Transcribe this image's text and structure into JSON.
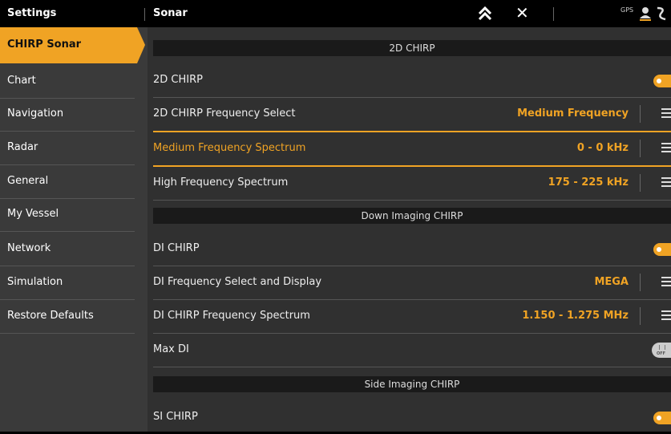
{
  "topbar": {
    "settings_title": "Settings",
    "page_title": "Sonar",
    "gps_label": "GPS"
  },
  "sidebar": {
    "items": [
      {
        "label": "CHIRP Sonar",
        "active": true
      },
      {
        "label": "Chart"
      },
      {
        "label": "Navigation"
      },
      {
        "label": "Radar"
      },
      {
        "label": "General"
      },
      {
        "label": "My Vessel"
      },
      {
        "label": "Network"
      },
      {
        "label": "Simulation"
      },
      {
        "label": "Restore Defaults"
      }
    ]
  },
  "sections": {
    "chirp2d": {
      "header": "2D CHIRP",
      "rows": [
        {
          "label": "2D CHIRP",
          "toggle": "on"
        },
        {
          "label": "2D CHIRP Frequency Select",
          "value": "Medium Frequency"
        },
        {
          "label": "Medium Frequency Spectrum",
          "value": "0 - 0 kHz",
          "selected": true
        },
        {
          "label": "High Frequency Spectrum",
          "value": "175 - 225 kHz"
        }
      ]
    },
    "di": {
      "header": "Down Imaging CHIRP",
      "rows": [
        {
          "label": "DI CHIRP",
          "toggle": "on"
        },
        {
          "label": "DI Frequency Select and Display",
          "value": "MEGA"
        },
        {
          "label": "DI CHIRP Frequency Spectrum",
          "value": "1.150 - 1.275 MHz"
        },
        {
          "label": "Max DI",
          "toggle": "off",
          "toggle_label": "OFF"
        }
      ]
    },
    "si": {
      "header": "Side Imaging CHIRP",
      "rows": [
        {
          "label": "SI CHIRP",
          "toggle": "on"
        }
      ]
    }
  },
  "colors": {
    "accent": "#f0a324",
    "background": "#303030",
    "sidebar": "#3a3a3a"
  }
}
